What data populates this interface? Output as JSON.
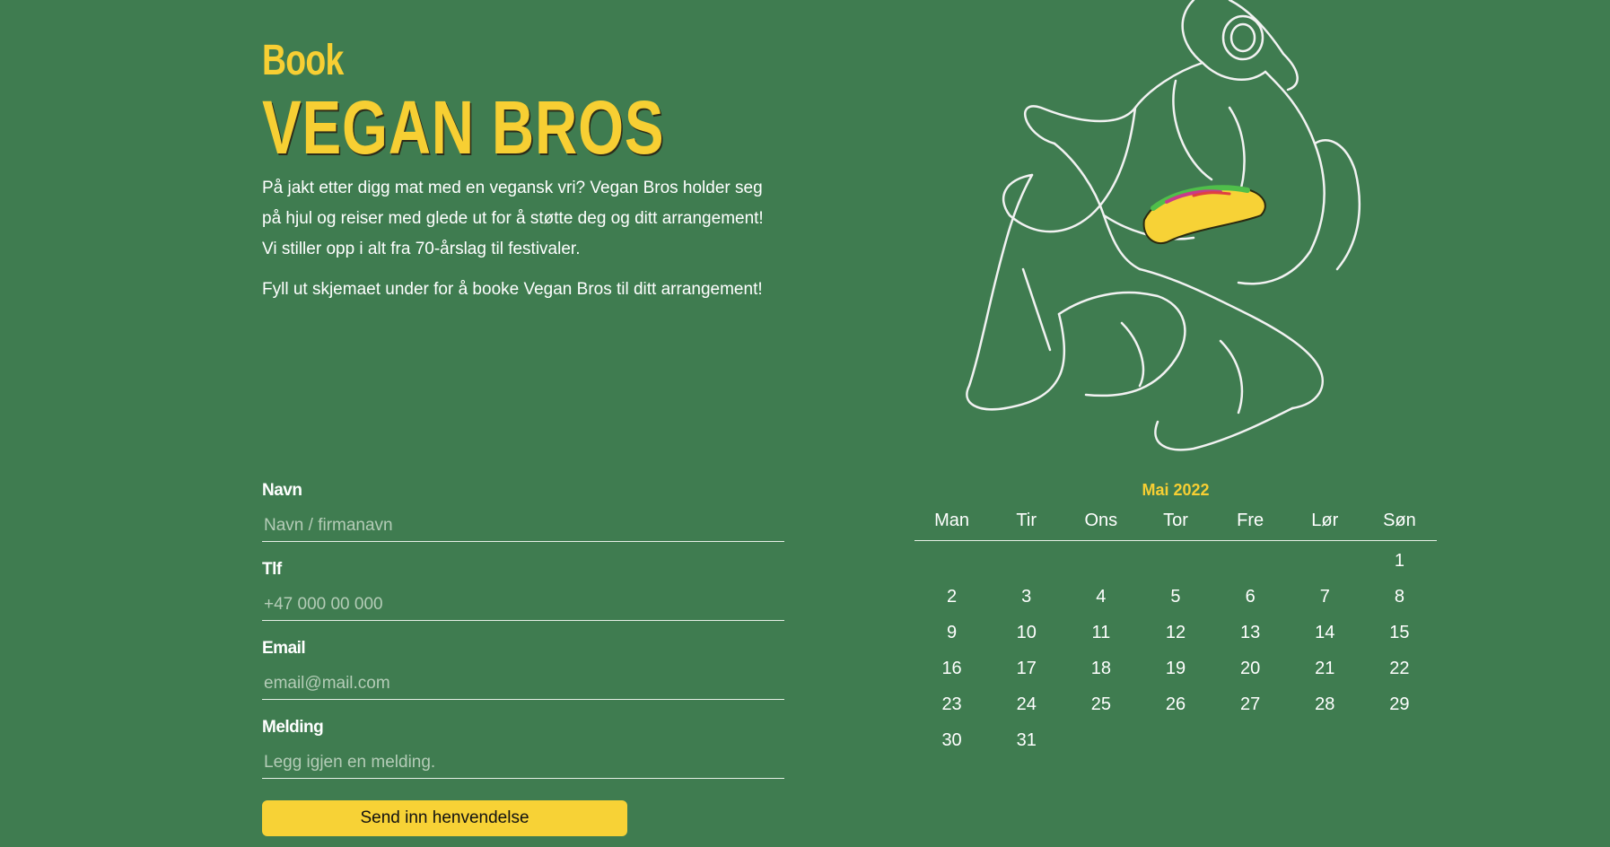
{
  "heading": {
    "small": "Book",
    "big": "VEGAN BROS"
  },
  "intro": {
    "p1": "På jakt etter digg mat med en vegansk vri? Vegan Bros holder seg på hjul og reiser med glede ut for å støtte deg og ditt arrangement! Vi stiller opp i alt fra 70-årslag til festivaler.",
    "p2": "Fyll ut skjemaet under for å booke Vegan Bros til ditt arrangement!"
  },
  "form": {
    "name": {
      "label": "Navn",
      "placeholder": "Navn / firmanavn",
      "value": ""
    },
    "phone": {
      "label": "Tlf",
      "placeholder": "+47 000 00 000",
      "value": ""
    },
    "email": {
      "label": "Email",
      "placeholder": "email@mail.com",
      "value": ""
    },
    "message": {
      "label": "Melding",
      "placeholder": "Legg igjen en melding.",
      "value": ""
    },
    "submit_label": "Send inn henvendelse"
  },
  "calendar": {
    "title": "Mai 2022",
    "weekdays": [
      "Man",
      "Tir",
      "Ons",
      "Tor",
      "Fre",
      "Lør",
      "Søn"
    ],
    "weeks": [
      [
        "",
        "",
        "",
        "",
        "",
        "",
        "1"
      ],
      [
        "2",
        "3",
        "4",
        "5",
        "6",
        "7",
        "8"
      ],
      [
        "9",
        "10",
        "11",
        "12",
        "13",
        "14",
        "15"
      ],
      [
        "16",
        "17",
        "18",
        "19",
        "20",
        "21",
        "22"
      ],
      [
        "23",
        "24",
        "25",
        "26",
        "27",
        "28",
        "29"
      ],
      [
        "30",
        "31",
        "",
        "",
        "",
        "",
        ""
      ]
    ]
  },
  "colors": {
    "background": "#3f7c50",
    "accent": "#f7cf33",
    "text": "#ffffff"
  },
  "illustration": {
    "icon": "yeti-eating-taco-illustration"
  }
}
